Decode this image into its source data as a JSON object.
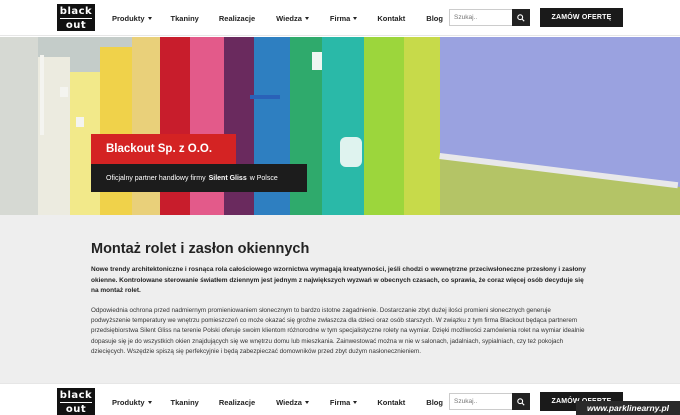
{
  "brand": {
    "logo_line1": "black",
    "logo_line2": "out"
  },
  "nav": {
    "items": [
      {
        "label": "Produkty",
        "dropdown": true
      },
      {
        "label": "Tkaniny",
        "dropdown": false
      },
      {
        "label": "Realizacje",
        "dropdown": false
      },
      {
        "label": "Wiedza",
        "dropdown": true
      },
      {
        "label": "Firma",
        "dropdown": true
      },
      {
        "label": "Kontakt",
        "dropdown": false
      },
      {
        "label": "Blog",
        "dropdown": false
      }
    ],
    "search_placeholder": "Szukaj..",
    "order_button": "ZAMÓW OFERTĘ"
  },
  "hero": {
    "title": "Blackout Sp. z O.O.",
    "subtitle_prefix": "Oficjalny partner handlowy firmy",
    "subtitle_brand": "Silent Gliss",
    "subtitle_suffix": "w Polsce",
    "slides": 2,
    "active_slide": 1
  },
  "content": {
    "title": "Montaż rolet i zasłon okiennych",
    "lead": "Nowe trendy architektoniczne i rosnąca rola całościowego wzornictwa wymagają kreatywności, jeśli chodzi o wewnętrzne przeciwsłoneczne przesłony i zasłony okienne. Kontrolowane sterowanie światłem dziennym jest jednym z największych wyzwań w obecnych czasach, co sprawia, że coraz więcej osób decyduje się na montaż rolet.",
    "body": "Odpowiednia ochrona przed nadmiernym promieniowaniem słonecznym to bardzo istotne zagadnienie. Dostarczanie zbyt dużej ilości promieni słonecznych generuje podwyższenie temperatury we wnętrzu pomieszczeń co może okazać się groźne zwłaszcza dla dzieci oraz osób starszych. W związku z tym firma Blackout będąca partnerem przedsiębiorstwa Silent Gliss na terenie Polski oferuje swoim klientom różnorodne w tym specjalistyczne rolety na wymiar. Dzięki możliwości zamówienia rolet na wymiar idealnie dopasuje się je do wszystkich okien znajdujących się we wnętrzu domu lub mieszkania. Zainwestować można w nie w salonach, jadalniach, sypialniach, czy też pokojach dziecięcych. Wszędzie spiszą się perfekcyjnie i będą zabezpieczać domowników przed zbyt dużym nasłonecznieniem."
  },
  "watermark": "www.parklinearny.pl",
  "colors": {
    "accent_red": "#d42323",
    "dark": "#1a1a1a",
    "content_bg": "#eeeeee"
  }
}
